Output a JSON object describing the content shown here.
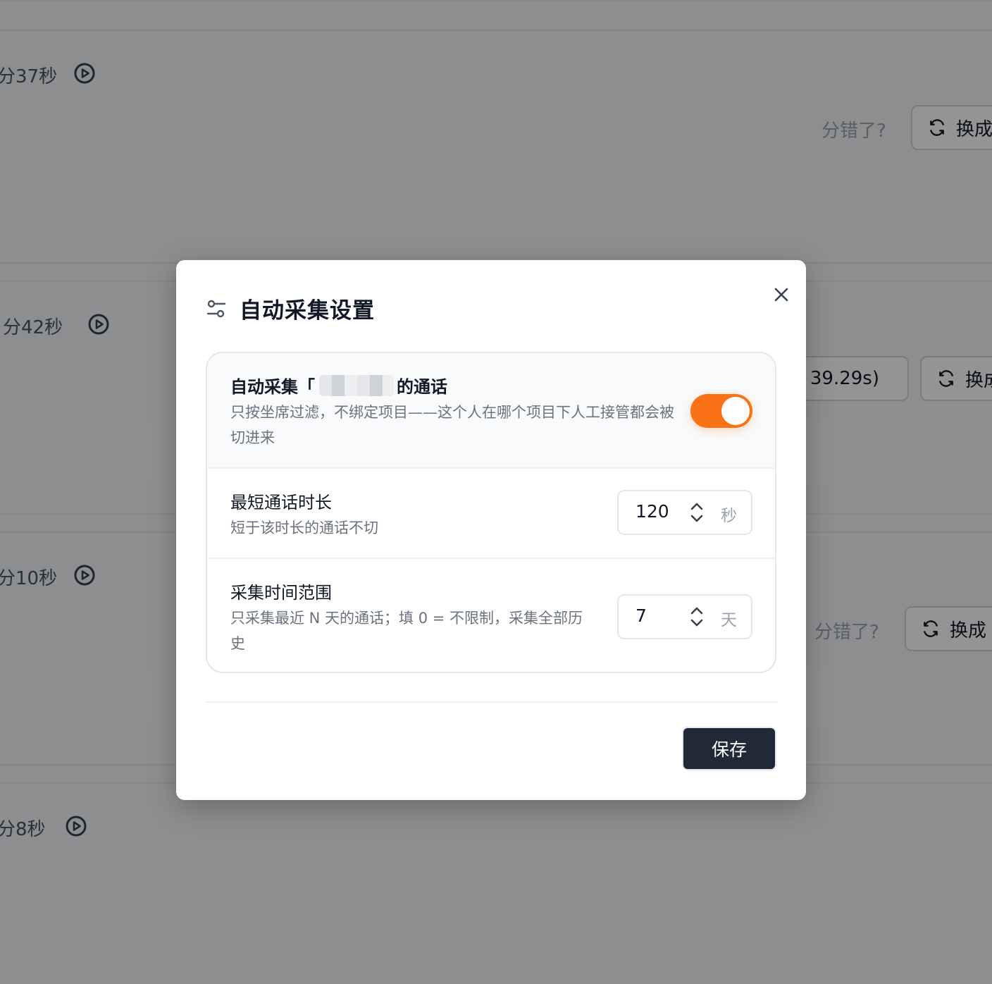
{
  "background": {
    "rows": [
      {
        "duration": "分37秒",
        "wrong_label": "分错了?",
        "switch_label": "换成"
      },
      {
        "duration": "分42秒",
        "time_chip": "39.29s)",
        "switch_label": "换成"
      },
      {
        "duration": "分10秒",
        "wrong_label": "分错了?",
        "switch_label": "换成"
      },
      {
        "duration": "分8秒"
      }
    ]
  },
  "dialog": {
    "title": "自动采集设置",
    "auto_collect": {
      "title_prefix": "自动采集「",
      "title_suffix": "的通话",
      "description": "只按坐席过滤，不绑定项目——这个人在哪个项目下人工接管都会被切进来",
      "enabled": true
    },
    "min_duration": {
      "title": "最短通话时长",
      "description": "短于该时长的通话不切",
      "value": "120",
      "unit": "秒"
    },
    "range": {
      "title": "采集时间范围",
      "description": "只采集最近 N 天的通话；填 0 = 不限制，采集全部历史",
      "value": "7",
      "unit": "天"
    },
    "save_label": "保存"
  },
  "colors": {
    "accent": "#f97316",
    "primary_button": "#1f2937"
  }
}
